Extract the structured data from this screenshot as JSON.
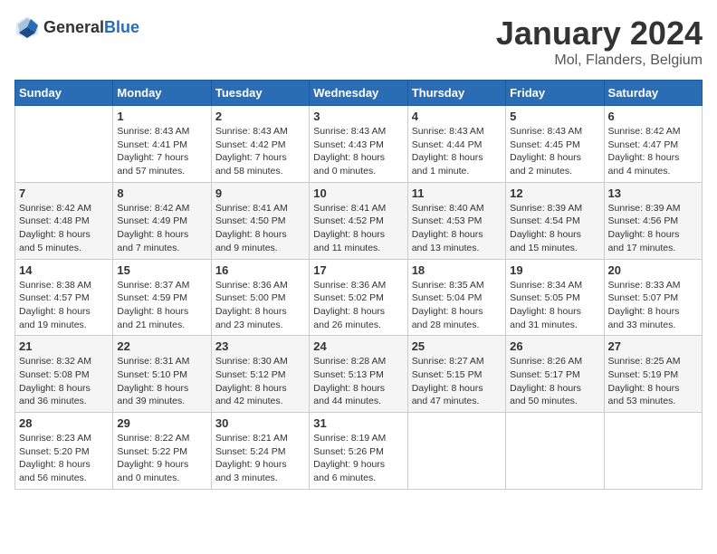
{
  "logo": {
    "text_general": "General",
    "text_blue": "Blue"
  },
  "title": "January 2024",
  "subtitle": "Mol, Flanders, Belgium",
  "days_of_week": [
    "Sunday",
    "Monday",
    "Tuesday",
    "Wednesday",
    "Thursday",
    "Friday",
    "Saturday"
  ],
  "weeks": [
    [
      {
        "day": "",
        "info": ""
      },
      {
        "day": "1",
        "info": "Sunrise: 8:43 AM\nSunset: 4:41 PM\nDaylight: 7 hours\nand 57 minutes."
      },
      {
        "day": "2",
        "info": "Sunrise: 8:43 AM\nSunset: 4:42 PM\nDaylight: 7 hours\nand 58 minutes."
      },
      {
        "day": "3",
        "info": "Sunrise: 8:43 AM\nSunset: 4:43 PM\nDaylight: 8 hours\nand 0 minutes."
      },
      {
        "day": "4",
        "info": "Sunrise: 8:43 AM\nSunset: 4:44 PM\nDaylight: 8 hours\nand 1 minute."
      },
      {
        "day": "5",
        "info": "Sunrise: 8:43 AM\nSunset: 4:45 PM\nDaylight: 8 hours\nand 2 minutes."
      },
      {
        "day": "6",
        "info": "Sunrise: 8:42 AM\nSunset: 4:47 PM\nDaylight: 8 hours\nand 4 minutes."
      }
    ],
    [
      {
        "day": "7",
        "info": "Sunrise: 8:42 AM\nSunset: 4:48 PM\nDaylight: 8 hours\nand 5 minutes."
      },
      {
        "day": "8",
        "info": "Sunrise: 8:42 AM\nSunset: 4:49 PM\nDaylight: 8 hours\nand 7 minutes."
      },
      {
        "day": "9",
        "info": "Sunrise: 8:41 AM\nSunset: 4:50 PM\nDaylight: 8 hours\nand 9 minutes."
      },
      {
        "day": "10",
        "info": "Sunrise: 8:41 AM\nSunset: 4:52 PM\nDaylight: 8 hours\nand 11 minutes."
      },
      {
        "day": "11",
        "info": "Sunrise: 8:40 AM\nSunset: 4:53 PM\nDaylight: 8 hours\nand 13 minutes."
      },
      {
        "day": "12",
        "info": "Sunrise: 8:39 AM\nSunset: 4:54 PM\nDaylight: 8 hours\nand 15 minutes."
      },
      {
        "day": "13",
        "info": "Sunrise: 8:39 AM\nSunset: 4:56 PM\nDaylight: 8 hours\nand 17 minutes."
      }
    ],
    [
      {
        "day": "14",
        "info": "Sunrise: 8:38 AM\nSunset: 4:57 PM\nDaylight: 8 hours\nand 19 minutes."
      },
      {
        "day": "15",
        "info": "Sunrise: 8:37 AM\nSunset: 4:59 PM\nDaylight: 8 hours\nand 21 minutes."
      },
      {
        "day": "16",
        "info": "Sunrise: 8:36 AM\nSunset: 5:00 PM\nDaylight: 8 hours\nand 23 minutes."
      },
      {
        "day": "17",
        "info": "Sunrise: 8:36 AM\nSunset: 5:02 PM\nDaylight: 8 hours\nand 26 minutes."
      },
      {
        "day": "18",
        "info": "Sunrise: 8:35 AM\nSunset: 5:04 PM\nDaylight: 8 hours\nand 28 minutes."
      },
      {
        "day": "19",
        "info": "Sunrise: 8:34 AM\nSunset: 5:05 PM\nDaylight: 8 hours\nand 31 minutes."
      },
      {
        "day": "20",
        "info": "Sunrise: 8:33 AM\nSunset: 5:07 PM\nDaylight: 8 hours\nand 33 minutes."
      }
    ],
    [
      {
        "day": "21",
        "info": "Sunrise: 8:32 AM\nSunset: 5:08 PM\nDaylight: 8 hours\nand 36 minutes."
      },
      {
        "day": "22",
        "info": "Sunrise: 8:31 AM\nSunset: 5:10 PM\nDaylight: 8 hours\nand 39 minutes."
      },
      {
        "day": "23",
        "info": "Sunrise: 8:30 AM\nSunset: 5:12 PM\nDaylight: 8 hours\nand 42 minutes."
      },
      {
        "day": "24",
        "info": "Sunrise: 8:28 AM\nSunset: 5:13 PM\nDaylight: 8 hours\nand 44 minutes."
      },
      {
        "day": "25",
        "info": "Sunrise: 8:27 AM\nSunset: 5:15 PM\nDaylight: 8 hours\nand 47 minutes."
      },
      {
        "day": "26",
        "info": "Sunrise: 8:26 AM\nSunset: 5:17 PM\nDaylight: 8 hours\nand 50 minutes."
      },
      {
        "day": "27",
        "info": "Sunrise: 8:25 AM\nSunset: 5:19 PM\nDaylight: 8 hours\nand 53 minutes."
      }
    ],
    [
      {
        "day": "28",
        "info": "Sunrise: 8:23 AM\nSunset: 5:20 PM\nDaylight: 8 hours\nand 56 minutes."
      },
      {
        "day": "29",
        "info": "Sunrise: 8:22 AM\nSunset: 5:22 PM\nDaylight: 9 hours\nand 0 minutes."
      },
      {
        "day": "30",
        "info": "Sunrise: 8:21 AM\nSunset: 5:24 PM\nDaylight: 9 hours\nand 3 minutes."
      },
      {
        "day": "31",
        "info": "Sunrise: 8:19 AM\nSunset: 5:26 PM\nDaylight: 9 hours\nand 6 minutes."
      },
      {
        "day": "",
        "info": ""
      },
      {
        "day": "",
        "info": ""
      },
      {
        "day": "",
        "info": ""
      }
    ]
  ]
}
